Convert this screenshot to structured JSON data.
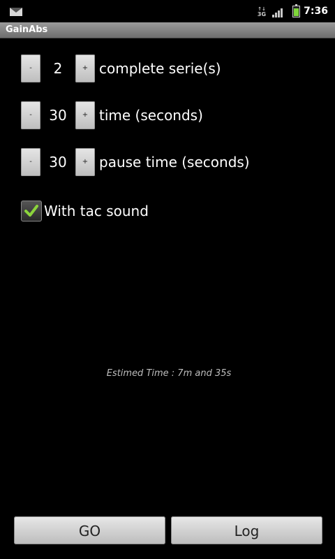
{
  "status_bar": {
    "network_type": "3G",
    "clock": "7:36",
    "icons": [
      "mail-icon",
      "data-activity-icon",
      "signal-icon",
      "battery-charging-icon"
    ]
  },
  "app": {
    "title": "GainAbs"
  },
  "settings": [
    {
      "minus_label": "-",
      "value": "2",
      "plus_label": "+",
      "label": "complete serie(s)"
    },
    {
      "minus_label": "-",
      "value": "30",
      "plus_label": "+",
      "label": "time (seconds)"
    },
    {
      "minus_label": "-",
      "value": "30",
      "plus_label": "+",
      "label": "pause time (seconds)"
    }
  ],
  "tac_sound": {
    "label": "With tac sound",
    "checked": true
  },
  "estimated_time": "Estimed Time : 7m and 35s",
  "buttons": {
    "go": "GO",
    "log": "Log"
  },
  "colors": {
    "background": "#000000",
    "check_accent": "#8cd43c"
  }
}
